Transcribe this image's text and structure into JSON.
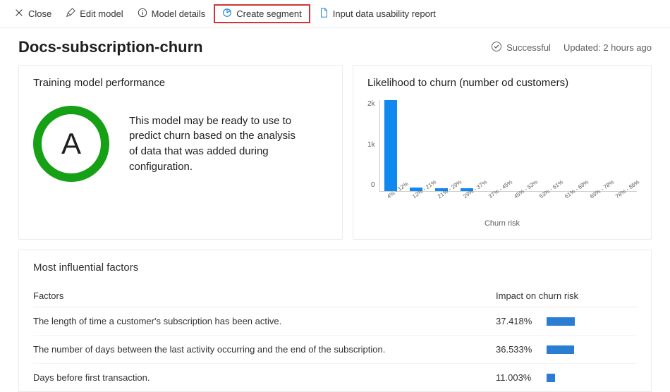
{
  "toolbar": {
    "close": "Close",
    "edit": "Edit model",
    "details": "Model details",
    "create_segment": "Create segment",
    "report": "Input data usability report"
  },
  "header": {
    "title": "Docs-subscription-churn",
    "status": "Successful",
    "updated": "Updated: 2 hours ago"
  },
  "performance": {
    "title": "Training model performance",
    "grade": "A",
    "description": "This model may be ready to use to predict churn based on the analysis of data that was added during configuration."
  },
  "chart_data": {
    "type": "bar",
    "title": "Likelihood to churn (number od customers)",
    "xlabel": "Churn risk",
    "ylabel": "",
    "ylim": [
      0,
      2000
    ],
    "y_ticks": [
      "2k",
      "1k",
      "0"
    ],
    "categories": [
      "4% - 12%",
      "12% - 21%",
      "21% - 29%",
      "29% - 37%",
      "37% - 45%",
      "45% - 53%",
      "53% - 61%",
      "61% - 69%",
      "69% - 78%",
      "78% - 86%"
    ],
    "values": [
      2050,
      80,
      60,
      60,
      0,
      0,
      0,
      0,
      0,
      0
    ]
  },
  "factors": {
    "title": "Most influential factors",
    "col1": "Factors",
    "col2": "Impact on churn risk",
    "rows": [
      {
        "label": "The length of time a customer's subscription has been active.",
        "pct": "37.418%",
        "w": 40
      },
      {
        "label": "The number of days between the last activity occurring and the end of the subscription.",
        "pct": "36.533%",
        "w": 39
      },
      {
        "label": "Days before first transaction.",
        "pct": "11.003%",
        "w": 12
      }
    ]
  }
}
